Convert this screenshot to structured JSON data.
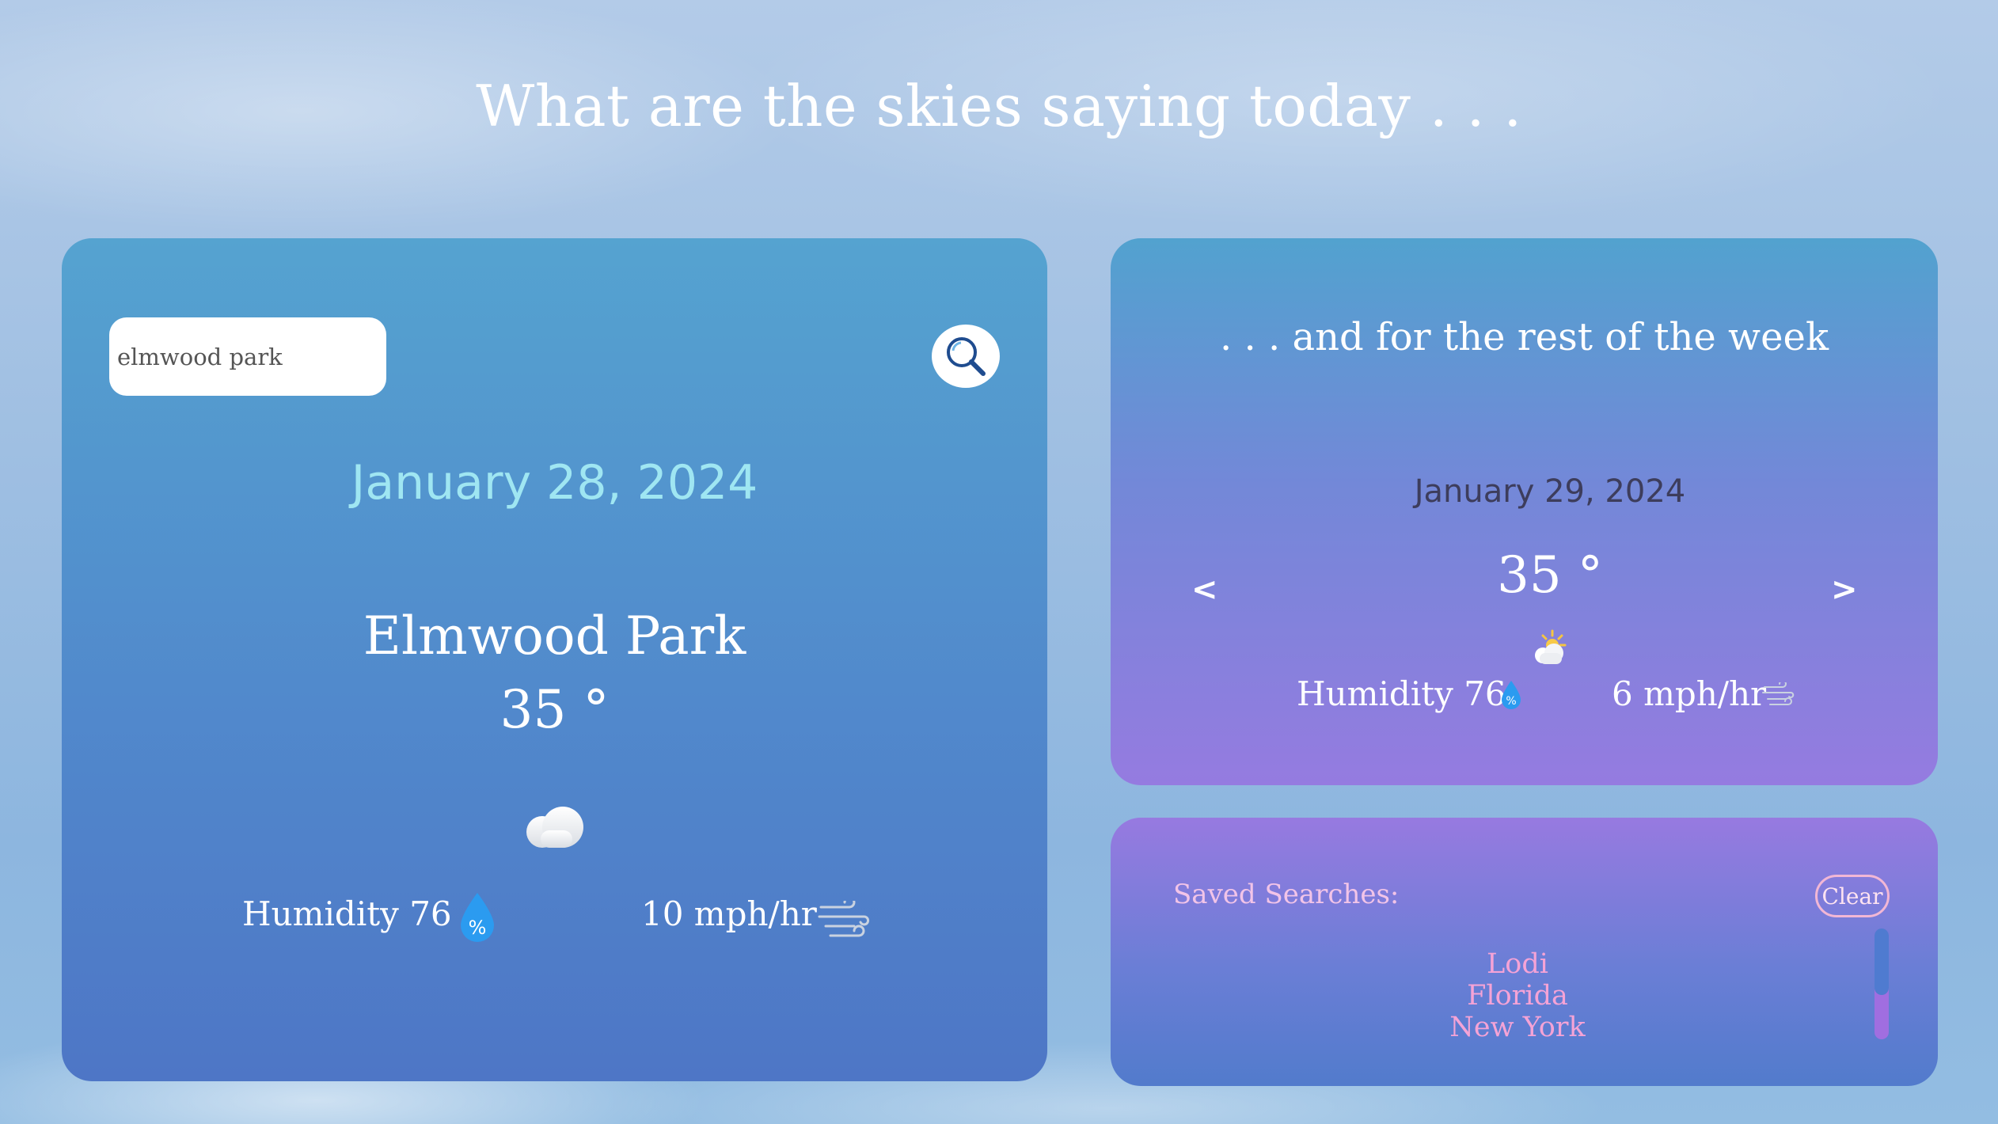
{
  "header": {
    "title": "What are the skies saying today . . ."
  },
  "current": {
    "search": {
      "value": "elmwood park",
      "placeholder": ""
    },
    "date": "January 28, 2024",
    "city": "Elmwood Park",
    "temperature": "35 °",
    "condition_icon": "cloud-icon",
    "humidity_label": "Humidity 76",
    "humidity_icon_text": "%",
    "wind": "10 mph/hr"
  },
  "week": {
    "title": ". . . and for the rest of the week",
    "date": "January 29, 2024",
    "temperature": "35 °",
    "condition_icon": "partly-sunny-icon",
    "humidity_label": "Humidity 76",
    "humidity_icon_text": "%",
    "wind": "6 mph/hr",
    "prev_label": "<",
    "next_label": ">"
  },
  "saved": {
    "label": "Saved Searches:",
    "clear_label": "Clear",
    "items": [
      "Lodi",
      "Florida",
      "New York"
    ]
  },
  "colors": {
    "date_accent": "#9fe6f2",
    "saved_text": "#f5a3d6",
    "week_date": "#3d3d5c"
  }
}
